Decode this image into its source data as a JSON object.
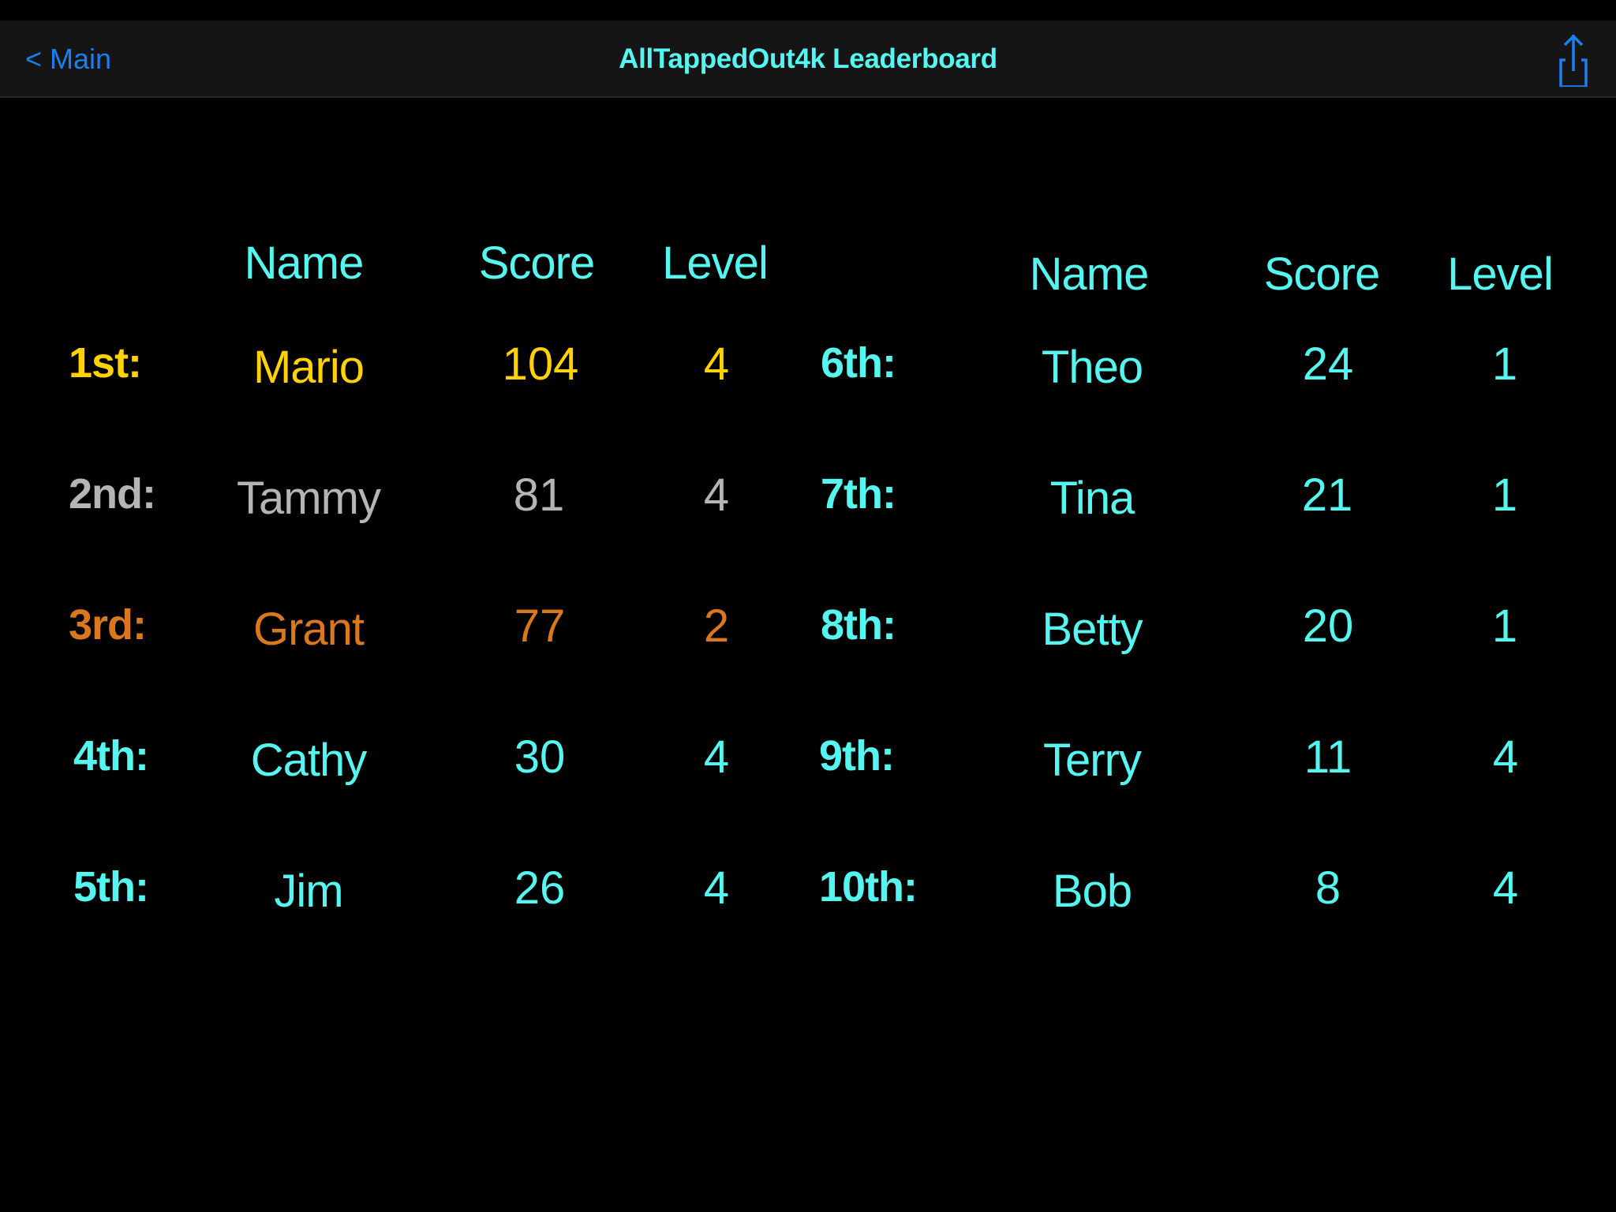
{
  "nav": {
    "back_label": "Main",
    "back_chevron": "<",
    "title": "AllTappedOut4k Leaderboard",
    "share_icon": "share-icon"
  },
  "colors": {
    "nav_background": "#151515",
    "back_link": "#1a7ff0",
    "title": "#55f5f0",
    "header": "#55f5f0",
    "gold": "#ffd200",
    "silver": "#b5b5b5",
    "bronze": "#d9781e",
    "default": "#55f5f0"
  },
  "columns": {
    "left": {
      "name": "Name",
      "score": "Score",
      "level": "Level"
    },
    "right": {
      "name": "Name",
      "score": "Score",
      "level": "Level"
    }
  },
  "leaderboard": [
    {
      "rank": "1st:",
      "name": "Mario",
      "score": "104",
      "level": "4",
      "tier": "gold"
    },
    {
      "rank": "2nd:",
      "name": "Tammy",
      "score": "81",
      "level": "4",
      "tier": "silver"
    },
    {
      "rank": "3rd:",
      "name": "Grant",
      "score": "77",
      "level": "2",
      "tier": "bronze"
    },
    {
      "rank": "4th:",
      "name": "Cathy",
      "score": "30",
      "level": "4",
      "tier": "default"
    },
    {
      "rank": "5th:",
      "name": "Jim",
      "score": "26",
      "level": "4",
      "tier": "default"
    },
    {
      "rank": "6th:",
      "name": "Theo",
      "score": "24",
      "level": "1",
      "tier": "default"
    },
    {
      "rank": "7th:",
      "name": "Tina",
      "score": "21",
      "level": "1",
      "tier": "default"
    },
    {
      "rank": "8th:",
      "name": "Betty",
      "score": "20",
      "level": "1",
      "tier": "default"
    },
    {
      "rank": "9th:",
      "name": "Terry",
      "score": "11",
      "level": "4",
      "tier": "default"
    },
    {
      "rank": "10th:",
      "name": "Bob",
      "score": "8",
      "level": "4",
      "tier": "default"
    }
  ]
}
